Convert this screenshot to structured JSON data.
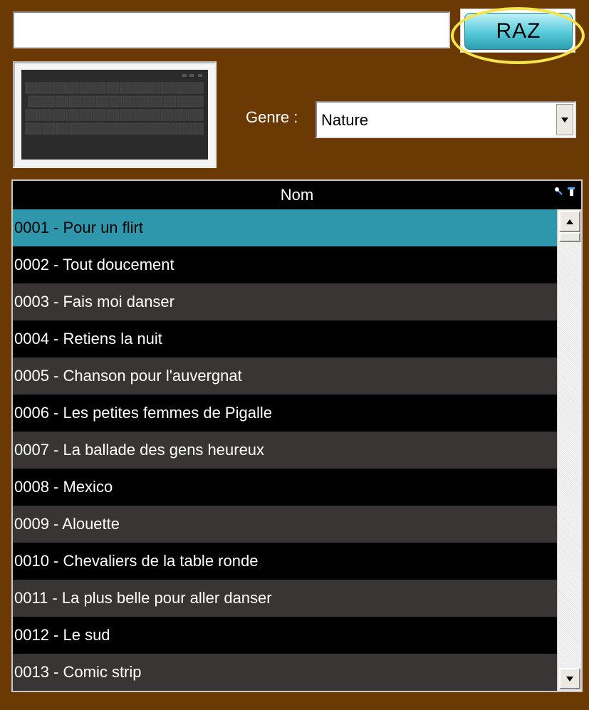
{
  "search": {
    "value": "",
    "placeholder": ""
  },
  "raz_button": {
    "label": "RAZ"
  },
  "genre": {
    "label": "Genre :",
    "selected": "Nature"
  },
  "table": {
    "column_header": "Nom",
    "rows": [
      "0001 - Pour un flirt",
      "0002 - Tout doucement",
      "0003 - Fais moi danser",
      "0004 - Retiens la nuit",
      "0005 - Chanson pour l'auvergnat",
      "0006 - Les petites femmes de Pigalle",
      "0007 - La ballade des gens heureux",
      "0008 - Mexico",
      "0009 - Alouette",
      "0010 - Chevaliers de la table ronde",
      "0011 - La plus belle pour aller danser",
      "0012 - Le sud",
      "0013 - Comic strip"
    ],
    "selected_index": 0
  },
  "icons": {
    "keyboard": "keyboard-icon",
    "search_tool": "magnifier-icon",
    "filter_tool": "filter-icon"
  },
  "colors": {
    "background": "#6b3a04",
    "selected_row": "#2f97ac",
    "raz_highlight": "#f5e44a"
  }
}
